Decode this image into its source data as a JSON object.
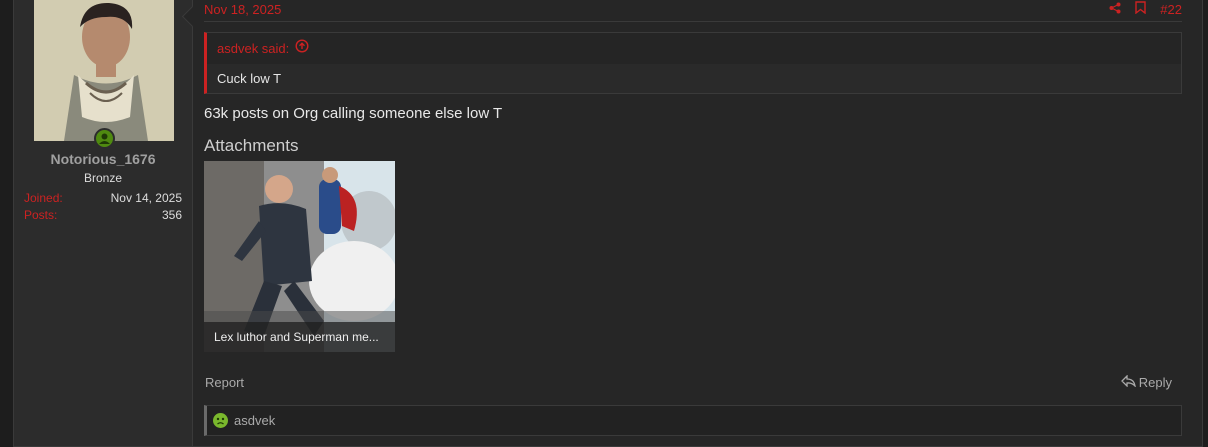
{
  "post": {
    "date": "Nov 18, 2025",
    "number": "#22",
    "quote": {
      "author_label": "asdvek said:",
      "text": "Cuck low T"
    },
    "message": "63k posts on Org calling someone else low T",
    "attachments_title": "Attachments",
    "attachment_caption": "Lex luthor and Superman me...",
    "report_label": "Report",
    "reply_label": "Reply",
    "reaction_user": "asdvek"
  },
  "user": {
    "name": "Notorious_1676",
    "rank": "Bronze",
    "joined_label": "Joined:",
    "joined_value": "Nov 14, 2025",
    "posts_label": "Posts:",
    "posts_value": "356"
  },
  "icons": {
    "share": "share-icon",
    "bookmark": "bookmark-icon",
    "quote_arrow": "arrow-up-circle-icon",
    "reply": "reply-icon",
    "reaction": "angry-reaction-icon"
  },
  "colors": {
    "accent": "#cc2222",
    "online": "#4f8a10",
    "reaction": "#7ab82d"
  }
}
